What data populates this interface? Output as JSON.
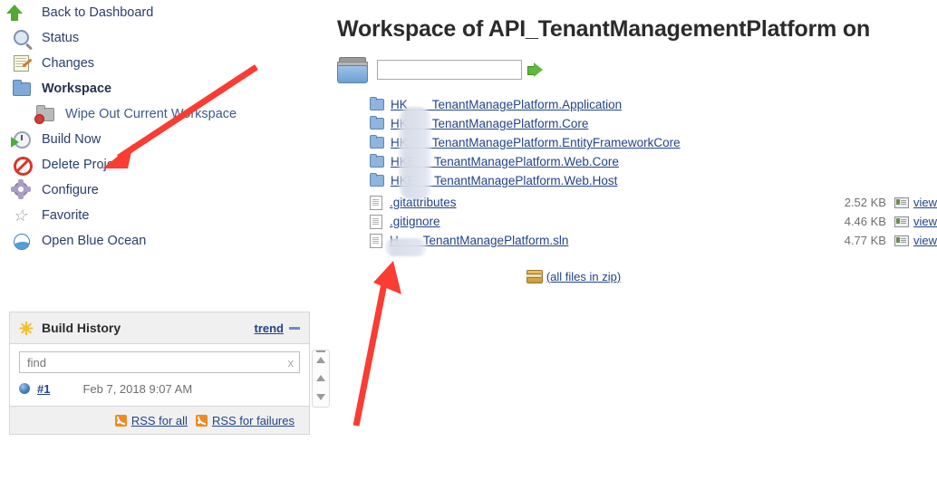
{
  "sidebar": {
    "items": [
      {
        "label": "Back to Dashboard",
        "icon": "up-arrow-icon",
        "bold": false,
        "sub": false
      },
      {
        "label": "Status",
        "icon": "magnifier-icon",
        "bold": false,
        "sub": false
      },
      {
        "label": "Changes",
        "icon": "changes-notepad-icon",
        "bold": false,
        "sub": false
      },
      {
        "label": "Workspace",
        "icon": "folder-icon",
        "bold": true,
        "sub": false
      },
      {
        "label": "Wipe Out Current Workspace",
        "icon": "folder-delete-icon",
        "bold": false,
        "sub": true
      },
      {
        "label": "Build Now",
        "icon": "build-clock-icon",
        "bold": false,
        "sub": false
      },
      {
        "label": "Delete Project",
        "icon": "ban-icon",
        "bold": false,
        "sub": false
      },
      {
        "label": "Configure",
        "icon": "gear-icon",
        "bold": false,
        "sub": false
      },
      {
        "label": "Favorite",
        "icon": "star-icon",
        "bold": false,
        "sub": false
      },
      {
        "label": "Open Blue Ocean",
        "icon": "blue-ocean-icon",
        "bold": false,
        "sub": false
      }
    ]
  },
  "build_history": {
    "title": "Build History",
    "trend_label": "trend",
    "find_placeholder": "find",
    "find_value": "",
    "clear_label": "x",
    "builds": [
      {
        "number": "#1",
        "date": "Feb 7, 2018 9:07 AM",
        "status_icon": "blue-ball-icon"
      }
    ],
    "rss_all": "RSS for all",
    "rss_failures": "RSS for failures"
  },
  "main": {
    "title": "Workspace of API_TenantManagementPlatform on",
    "path_value": "",
    "path_placeholder": "",
    "go_icon": "green-arrow-icon",
    "folders": [
      {
        "name": "HK  TenantManagePlatform.Application"
      },
      {
        "name": "HK  TenantManagePlatform.Core"
      },
      {
        "name": "HK  TenantManagePlatform.EntityFrameworkCore"
      },
      {
        "name": "HKE  TenantManagePlatform.Web.Core"
      },
      {
        "name": "HKE  TenantManagePlatform.Web.Host"
      }
    ],
    "files": [
      {
        "name": ".gitattributes",
        "size": "2.52 KB",
        "view": "view"
      },
      {
        "name": ".gitignore",
        "size": "4.46 KB",
        "view": "view"
      },
      {
        "name": "H   TenantManagePlatform.sln",
        "size": "4.77 KB",
        "view": "view"
      }
    ],
    "zip_label": "(all files in zip)"
  },
  "colors": {
    "link": "#224488",
    "panel_header": "#f0f0f0",
    "annotation_arrow": "#fa3c32",
    "build_ball": "#3f7fc0",
    "rss_orange": "#f08a24"
  }
}
